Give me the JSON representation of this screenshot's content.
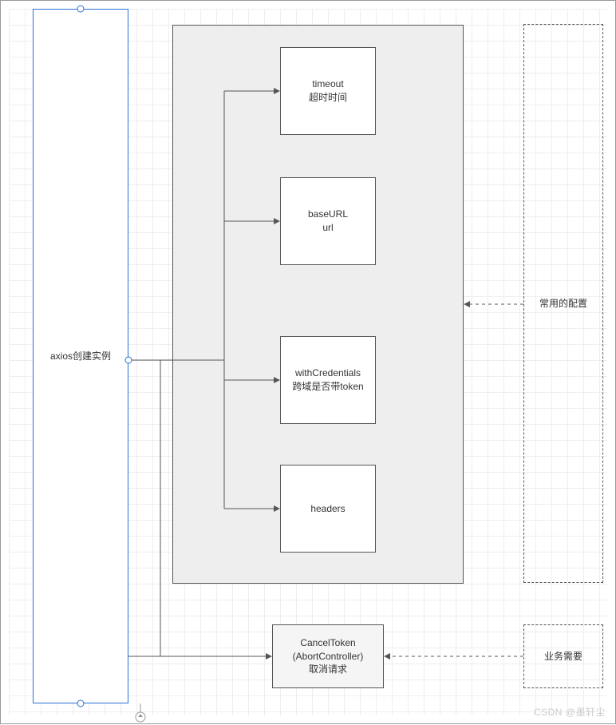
{
  "diagram": {
    "leftBox": {
      "label": "axios创建实例"
    },
    "configGroup": {
      "items": [
        {
          "line1": "timeout",
          "line2": "超时时间"
        },
        {
          "line1": "baseURL",
          "line2": "url"
        },
        {
          "line1": "withCredentials",
          "line2": "跨域是否带token"
        },
        {
          "line1": "headers",
          "line2": ""
        }
      ]
    },
    "cancelBox": {
      "line1": "CancelToken",
      "line2": "(AbortController)",
      "line3": "取消请求"
    },
    "rightDashed": [
      {
        "label": "常用的配置"
      },
      {
        "label": "业务需要"
      }
    ]
  },
  "watermark": "CSDN @墨轩尘"
}
